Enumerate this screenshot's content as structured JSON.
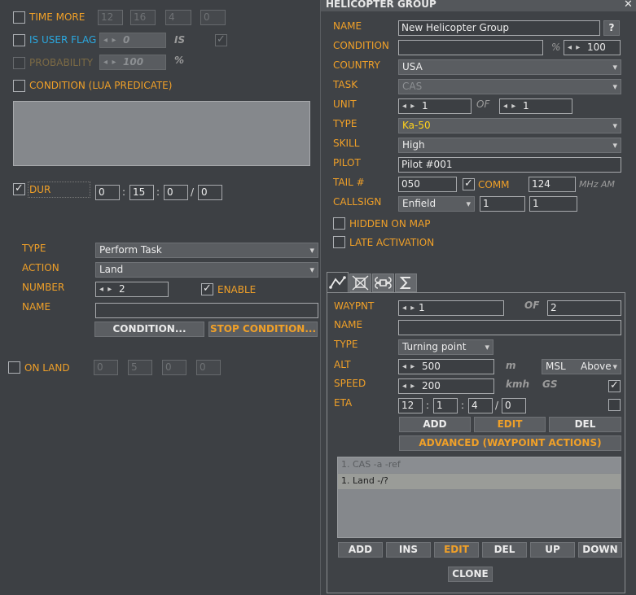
{
  "trigger": {
    "time_more": {
      "label": "TIME MORE",
      "values": [
        "12",
        "16",
        "4",
        "0"
      ]
    },
    "user_flag": {
      "label": "IS USER FLAG",
      "value": "0",
      "is_label": "IS"
    },
    "probability": {
      "label": "PROBABILITY",
      "value": "100",
      "unit": "%"
    },
    "condition_lua": {
      "label": "CONDITION (LUA PREDICATE)"
    },
    "dur": {
      "label": "DUR",
      "values": [
        "0",
        "15",
        "0",
        "0"
      ]
    },
    "type": {
      "label": "TYPE",
      "value": "Perform Task"
    },
    "action": {
      "label": "ACTION",
      "value": "Land"
    },
    "number": {
      "label": "NUMBER",
      "value": "2"
    },
    "enable": {
      "label": "ENABLE"
    },
    "name": {
      "label": "NAME",
      "value": ""
    },
    "condition_button": "CONDITION...",
    "stop_condition_button": "STOP CONDITION...",
    "on_land": {
      "label": "ON LAND",
      "values": [
        "0",
        "5",
        "0",
        "0"
      ]
    }
  },
  "group": {
    "title": "HELICOPTER GROUP",
    "close": "✕",
    "name_label": "NAME",
    "name_value": "New Helicopter Group",
    "help": "?",
    "condition_label": "CONDITION",
    "condition_value": "",
    "percent": "%",
    "condition_percent": "100",
    "country_label": "COUNTRY",
    "country_value": "USA",
    "task_label": "TASK",
    "task_value": "CAS",
    "unit_label": "UNIT",
    "unit_value": "1",
    "of_label": "OF",
    "unit_of_value": "1",
    "type_label": "TYPE",
    "type_value": "Ka-50",
    "skill_label": "SKILL",
    "skill_value": "High",
    "pilot_label": "PILOT",
    "pilot_value": "Pilot #001",
    "tail_label": "TAIL #",
    "tail_value": "050",
    "comm_label": "COMM",
    "comm_value": "124",
    "comm_unit": "MHz AM",
    "callsign_label": "CALLSIGN",
    "callsign_value": "Enfield",
    "callsign_n1": "1",
    "callsign_n2": "1",
    "hidden_label": "HIDDEN ON MAP",
    "late_label": "LATE ACTIVATION"
  },
  "waypoint": {
    "waypnt_label": "WAYPNT",
    "waypnt_value": "1",
    "of_label": "OF",
    "of_value": "2",
    "name_label": "NAME",
    "name_value": "",
    "type_label": "TYPE",
    "type_value": "Turning point",
    "alt_label": "ALT",
    "alt_value": "500",
    "alt_unit": "m",
    "alt_ref": "MSL",
    "alt_ref2": "Above",
    "speed_label": "SPEED",
    "speed_value": "200",
    "speed_unit": "kmh",
    "gs_label": "GS",
    "eta_label": "ETA",
    "eta_values": [
      "12",
      "1",
      "4",
      "0"
    ],
    "add": "ADD",
    "edit": "EDIT",
    "del": "DEL",
    "advanced": "ADVANCED (WAYPOINT ACTIONS)",
    "actions": [
      "1. CAS -a -ref",
      "1. Land -/?"
    ],
    "list_buttons": [
      "ADD",
      "INS",
      "EDIT",
      "DEL",
      "UP",
      "DOWN"
    ],
    "clone": "CLONE"
  }
}
